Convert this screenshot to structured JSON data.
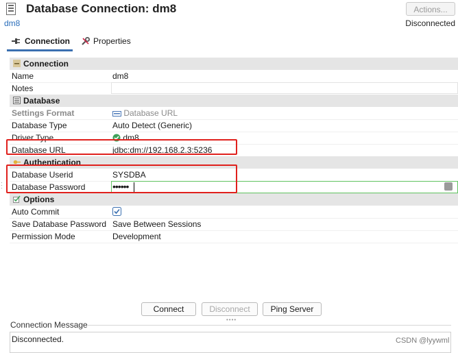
{
  "header": {
    "title": "Database Connection: dm8",
    "subtitle": "dm8",
    "actions_label": "Actions...",
    "status": "Disconnected"
  },
  "tabs": [
    {
      "label": "Connection",
      "active": true
    },
    {
      "label": "Properties",
      "active": false
    }
  ],
  "sections": {
    "connection": {
      "title": "Connection",
      "name_label": "Name",
      "name_value": "dm8",
      "notes_label": "Notes",
      "notes_value": ""
    },
    "database": {
      "title": "Database",
      "settings_format_label": "Settings Format",
      "settings_format_value": "Database URL",
      "database_type_label": "Database Type",
      "database_type_value": "Auto Detect (Generic)",
      "driver_type_label": "Driver Type",
      "driver_type_value": "dm8",
      "database_url_label": "Database URL",
      "database_url_value": "jdbc:dm://192.168.2.3:5236"
    },
    "authentication": {
      "title": "Authentication",
      "userid_label": "Database Userid",
      "userid_value": "SYSDBA",
      "password_label": "Database Password",
      "password_value": "••••••"
    },
    "options": {
      "title": "Options",
      "auto_commit_label": "Auto Commit",
      "auto_commit_checked": true,
      "save_password_label": "Save Database Password",
      "save_password_value": "Save Between Sessions",
      "permission_mode_label": "Permission Mode",
      "permission_mode_value": "Development"
    }
  },
  "buttons": {
    "connect": "Connect",
    "disconnect": "Disconnect",
    "ping": "Ping Server"
  },
  "message": {
    "label": "Connection Message",
    "text": "Disconnected."
  },
  "watermark": "CSDN @lyywml",
  "colors": {
    "accent": "#3a6fb0",
    "link": "#2a6ebb",
    "highlight_box": "#e0201c",
    "focus_border": "#5fc35f",
    "category_bg": "#e5e5e5"
  },
  "icons": {
    "header": "database-icon",
    "connection_tab": "plug-icon",
    "properties_tab": "wrench-icon",
    "driver": "check-circle-icon",
    "settings_format": "url-icon",
    "auto_commit": "checkbox-checked-icon"
  }
}
